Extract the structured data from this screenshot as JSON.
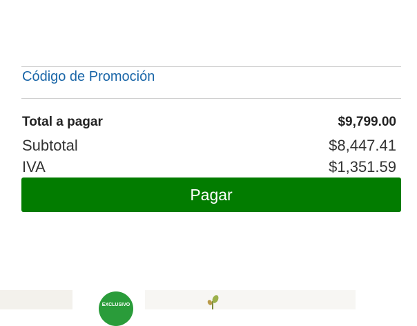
{
  "promo": {
    "link_label": "Código de Promoción"
  },
  "summary": {
    "total_label": "Total a pagar",
    "total_value": "$9,799.00",
    "subtotal_label": "Subtotal",
    "subtotal_value": "$8,447.41",
    "iva_label": "IVA",
    "iva_value": "$1,351.59"
  },
  "actions": {
    "pay_label": "Pagar"
  },
  "products_strip": {
    "badge_text": "EXCLUSIVO"
  },
  "colors": {
    "link": "#1a66a8",
    "pay_button": "#027c00",
    "badge": "#2a9c3a"
  }
}
